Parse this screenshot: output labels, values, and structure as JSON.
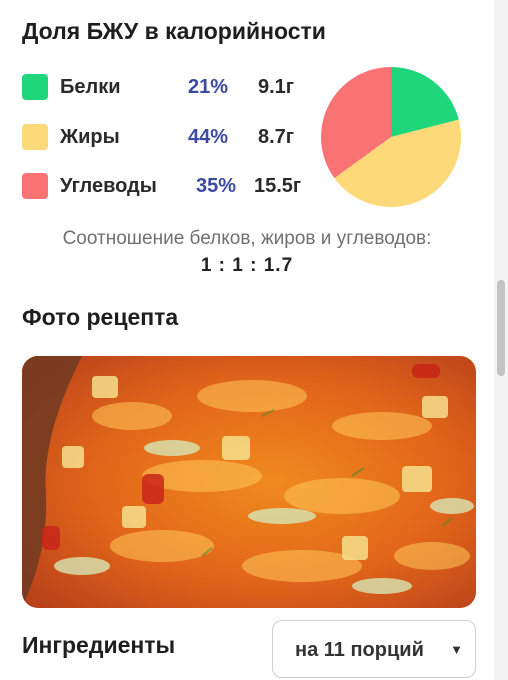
{
  "bju_section": {
    "title": "Доля БЖУ в калорийности",
    "macros": [
      {
        "name": "Белки",
        "percent": "21%",
        "grams": "9.1г",
        "color": "#1fd67a",
        "share": 21
      },
      {
        "name": "Жиры",
        "percent": "44%",
        "grams": "8.7г",
        "color": "#fdd97a",
        "share": 44
      },
      {
        "name": "Углеводы",
        "percent": "35%",
        "grams": "15.5г",
        "color": "#f97374",
        "share": 35
      }
    ],
    "ratio_caption": "Соотношение белков, жиров и углеводов:",
    "ratio_value": "1 : 1 : 1.7"
  },
  "photo_section": {
    "title": "Фото рецепта"
  },
  "ingredients_section": {
    "title": "Ингредиенты",
    "portions_selected": "на 11 порций",
    "caret_icon": "triangle-down-icon"
  }
}
